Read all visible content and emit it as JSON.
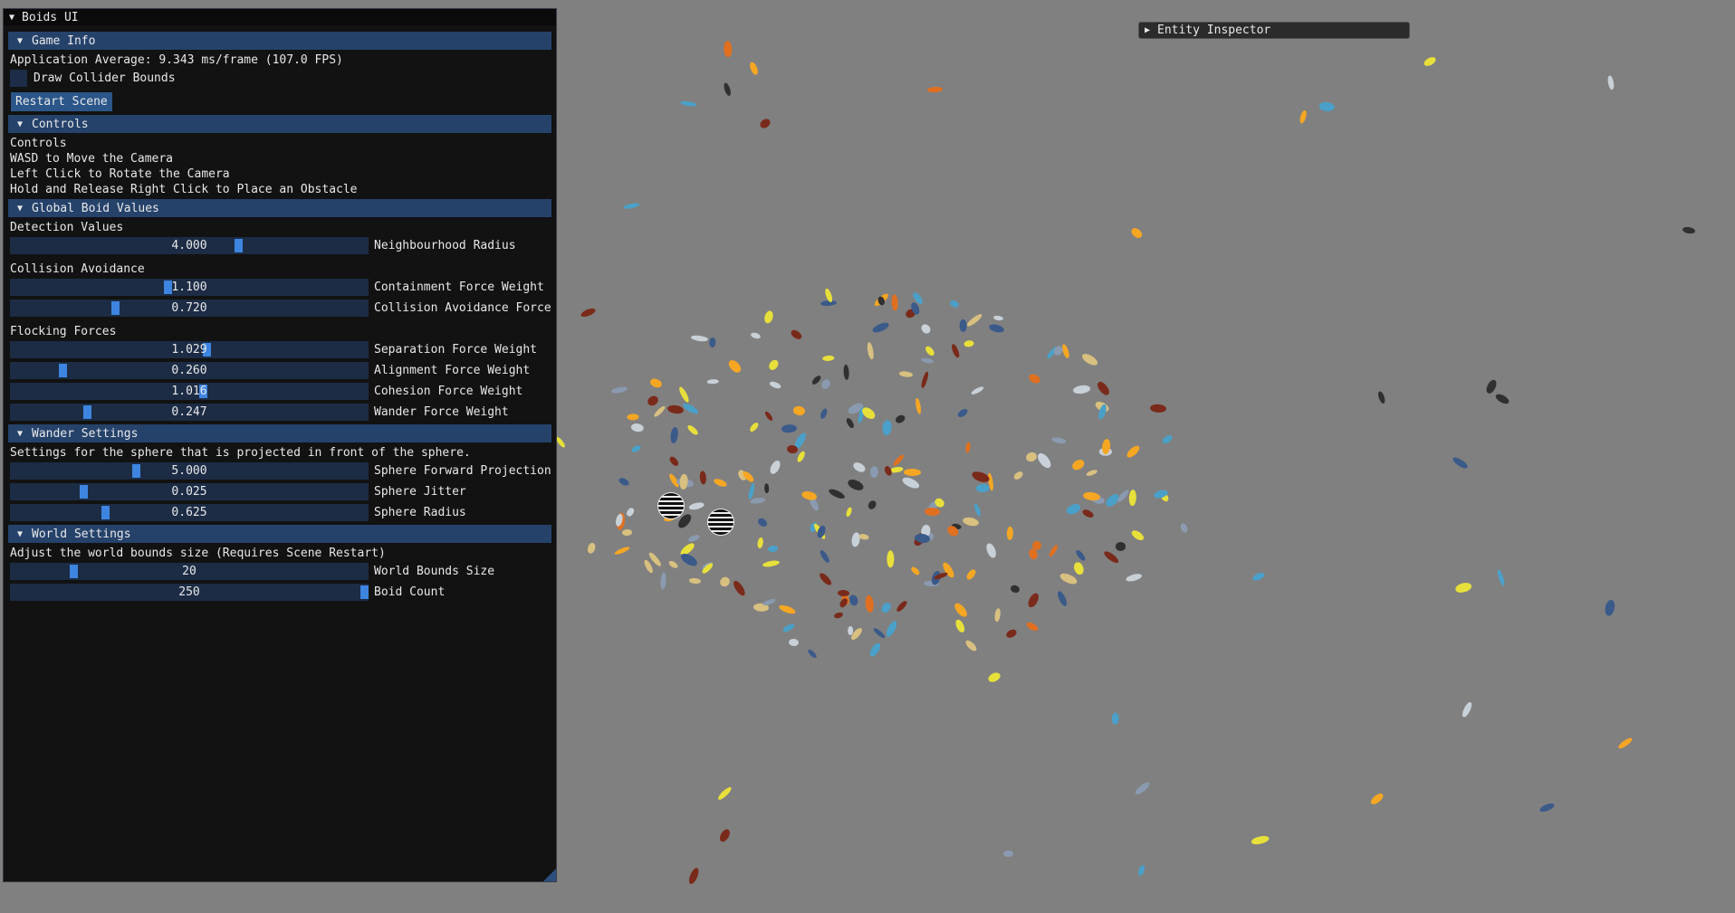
{
  "window": {
    "title": "Boids UI"
  },
  "game_info": {
    "header": "Game Info",
    "fps_text": "Application Average: 9.343 ms/frame (107.0 FPS)",
    "draw_collider_label": "Draw Collider Bounds",
    "draw_collider_checked": false,
    "restart_label": "Restart Scene"
  },
  "controls": {
    "header": "Controls",
    "lines": [
      "Controls",
      "WASD to Move the Camera",
      "Left Click to Rotate the Camera",
      "Hold and Release Right Click to Place an Obstacle"
    ]
  },
  "global_boid": {
    "header": "Global Boid Values",
    "detection_label": "Detection Values",
    "collision_label": "Collision Avoidance",
    "flocking_label": "Flocking Forces",
    "sliders": {
      "neighbourhood": {
        "value": "4.000",
        "label": "Neighbourhood Radius",
        "fill": 0.64
      },
      "containment": {
        "value": "1.100",
        "label": "Containment Force Weight",
        "fill": 0.44
      },
      "collision": {
        "value": "0.720",
        "label": "Collision Avoidance Force Weight",
        "fill": 0.29
      },
      "separation": {
        "value": "1.029",
        "label": "Separation Force Weight",
        "fill": 0.55
      },
      "alignment": {
        "value": "0.260",
        "label": "Alignment Force Weight",
        "fill": 0.14
      },
      "cohesion": {
        "value": "1.016",
        "label": "Cohesion Force Weight",
        "fill": 0.54
      },
      "wander": {
        "value": "0.247",
        "label": "Wander Force Weight",
        "fill": 0.21
      }
    }
  },
  "wander": {
    "header": "Wander Settings",
    "description": "Settings for the sphere that is projected in front of the sphere.",
    "sliders": {
      "projection": {
        "value": "5.000",
        "label": "Sphere Forward Projection",
        "fill": 0.35
      },
      "jitter": {
        "value": "0.025",
        "label": "Sphere Jitter",
        "fill": 0.2
      },
      "radius": {
        "value": "0.625",
        "label": "Sphere Radius",
        "fill": 0.26
      }
    }
  },
  "world": {
    "header": "World Settings",
    "description": "Adjust the world bounds size (Requires Scene Restart)",
    "sliders": {
      "bounds": {
        "value": "20",
        "label": "World Bounds Size",
        "fill": 0.17
      },
      "boids": {
        "value": "250",
        "label": "Boid Count",
        "fill": 1.0
      }
    }
  },
  "inspector": {
    "title": "Entity Inspector"
  },
  "colors": {
    "background": "#808080",
    "header": "#25426b",
    "slider_grab": "#3d85e0",
    "fish_palette": [
      "#f5a623",
      "#e8e03a",
      "#7a2a1a",
      "#4aa0c8",
      "#d8c080",
      "#3a5a8a",
      "#e07020",
      "#c8d0d8",
      "#303030",
      "#8a9ab0"
    ]
  }
}
